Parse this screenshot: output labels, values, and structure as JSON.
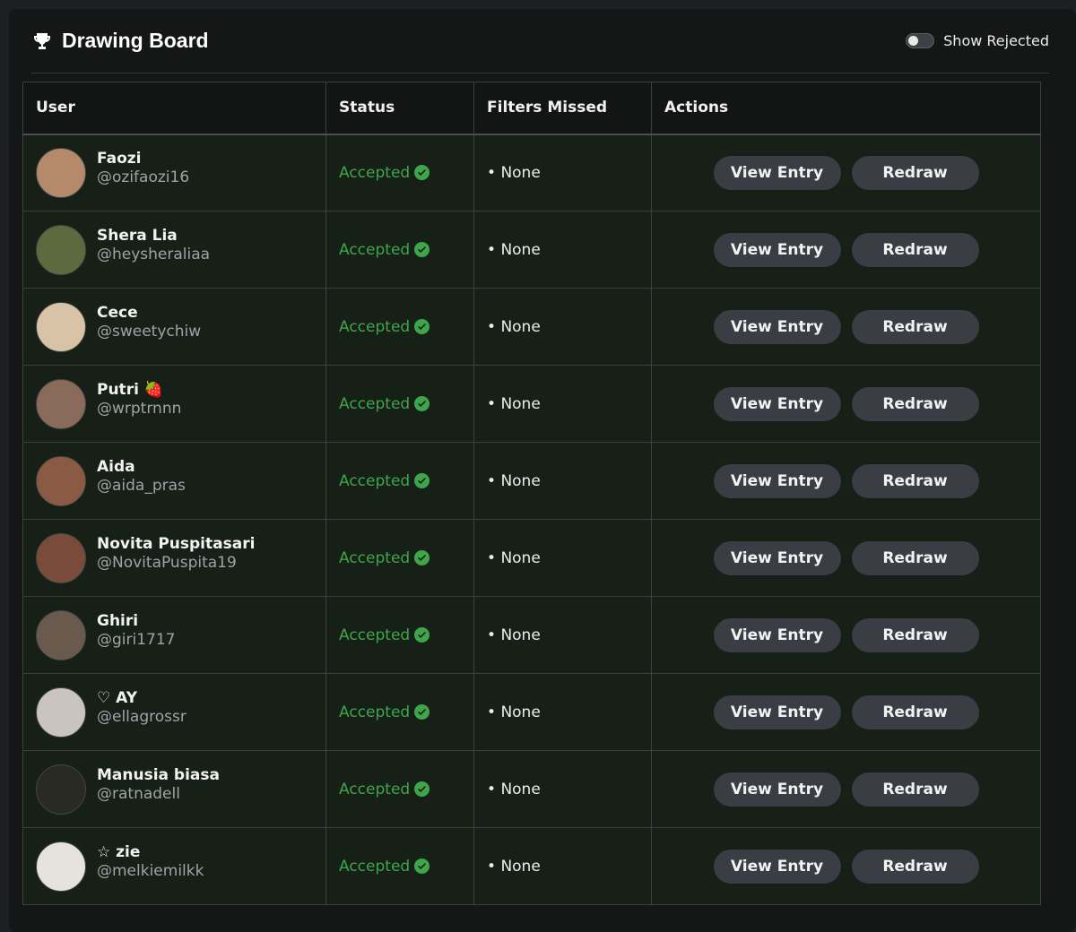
{
  "header": {
    "title": "Drawing Board",
    "trophy_icon": "trophy-icon",
    "toggle_label": "Show Rejected",
    "toggle_on": false
  },
  "table": {
    "columns": [
      "User",
      "Status",
      "Filters Missed",
      "Actions"
    ],
    "rows": [
      {
        "name": "Faozi",
        "handle": "@ozifaozi16",
        "status": "Accepted",
        "filters": "None",
        "view": "View Entry",
        "redraw": "Redraw",
        "avatar_color": "#b58a6a"
      },
      {
        "name": "Shera Lia",
        "handle": "@heysheraliaa",
        "status": "Accepted",
        "filters": "None",
        "view": "View Entry",
        "redraw": "Redraw",
        "avatar_color": "#5c6a3e"
      },
      {
        "name": "Cece",
        "handle": "@sweetychiw",
        "status": "Accepted",
        "filters": "None",
        "view": "View Entry",
        "redraw": "Redraw",
        "avatar_color": "#d8c3a6"
      },
      {
        "name": "Putri 🍓",
        "handle": "@wrptrnnn",
        "status": "Accepted",
        "filters": "None",
        "view": "View Entry",
        "redraw": "Redraw",
        "avatar_color": "#8a6a5a"
      },
      {
        "name": "Aida",
        "handle": "@aida_pras",
        "status": "Accepted",
        "filters": "None",
        "view": "View Entry",
        "redraw": "Redraw",
        "avatar_color": "#8a5a44"
      },
      {
        "name": "Novita Puspitasari",
        "handle": "@NovitaPuspita19",
        "status": "Accepted",
        "filters": "None",
        "view": "View Entry",
        "redraw": "Redraw",
        "avatar_color": "#7a4a3a"
      },
      {
        "name": "Ghiri",
        "handle": "@giri1717",
        "status": "Accepted",
        "filters": "None",
        "view": "View Entry",
        "redraw": "Redraw",
        "avatar_color": "#6a5a4e"
      },
      {
        "name": "♡ AY",
        "handle": "@ellagrossr",
        "status": "Accepted",
        "filters": "None",
        "view": "View Entry",
        "redraw": "Redraw",
        "avatar_color": "#c9c4bf"
      },
      {
        "name": "Manusia biasa",
        "handle": "@ratnadell",
        "status": "Accepted",
        "filters": "None",
        "view": "View Entry",
        "redraw": "Redraw",
        "avatar_color": "#2a2a24"
      },
      {
        "name": "☆ zie",
        "handle": "@melkiemilkk",
        "status": "Accepted",
        "filters": "None",
        "view": "View Entry",
        "redraw": "Redraw",
        "avatar_color": "#e6e3df"
      }
    ]
  },
  "colors": {
    "accepted": "#3fa54b",
    "button_bg": "#3a3e44",
    "row_bg": "#172017"
  }
}
